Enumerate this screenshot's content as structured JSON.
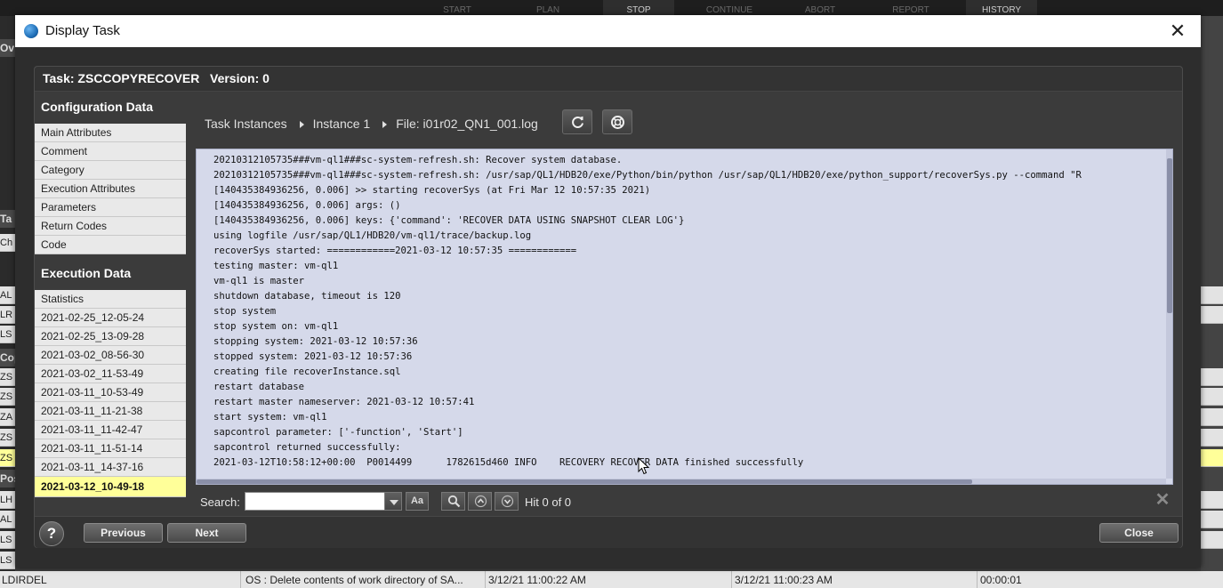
{
  "background": {
    "toolbar_tabs": [
      {
        "label": "START",
        "active": false
      },
      {
        "label": "PLAN",
        "active": false
      },
      {
        "label": "STOP",
        "active": true
      },
      {
        "label": "CONTINUE",
        "active": false
      },
      {
        "label": "ABORT",
        "active": false
      },
      {
        "label": "REPORT",
        "active": false
      },
      {
        "label": "HISTORY",
        "active": true
      }
    ],
    "left_fragments": [
      "Ov",
      "Ta",
      "Ch",
      "AL",
      "LR",
      "LS",
      "Cop",
      "ZS",
      "ZS",
      "ZA",
      "ZS",
      "ZS",
      "Pos",
      "LH",
      "AL",
      "LS",
      "LS"
    ],
    "bottom_row": {
      "name": "LDIRDEL",
      "description": "OS : Delete contents of work directory of SA...",
      "start": "3/12/21 11:00:22 AM",
      "end": "3/12/21 11:00:23 AM",
      "duration": "00:00:01"
    }
  },
  "dialog": {
    "title": "Display Task",
    "task_header": "Task: ZSCCOPYRECOVER   Version: 0",
    "configuration": {
      "heading": "Configuration Data",
      "items": [
        "Main Attributes",
        "Comment",
        "Category",
        "Execution Attributes",
        "Parameters",
        "Return Codes",
        "Code"
      ]
    },
    "execution": {
      "heading": "Execution Data",
      "items": [
        "Statistics",
        "2021-02-25_12-05-24",
        "2021-02-25_13-09-28",
        "2021-03-02_08-56-30",
        "2021-03-02_11-53-49",
        "2021-03-11_10-53-49",
        "2021-03-11_11-21-38",
        "2021-03-11_11-42-47",
        "2021-03-11_11-51-14",
        "2021-03-11_14-37-16",
        "2021-03-12_10-49-18"
      ],
      "selected": "2021-03-12_10-49-18"
    },
    "breadcrumb": {
      "task_instances": "Task Instances",
      "instance": "Instance 1",
      "file": "File: i01r02_QN1_001.log"
    },
    "toolbar_icons": [
      "refresh-icon",
      "lifebuoy-icon"
    ],
    "log_lines": [
      "20210312105735###vm-ql1###sc-system-refresh.sh: Recover system database.",
      "20210312105735###vm-ql1###sc-system-refresh.sh: /usr/sap/QL1/HDB20/exe/Python/bin/python /usr/sap/QL1/HDB20/exe/python_support/recoverSys.py --command \"R",
      "[140435384936256, 0.006] >> starting recoverSys (at Fri Mar 12 10:57:35 2021)",
      "[140435384936256, 0.006] args: ()",
      "[140435384936256, 0.006] keys: {'command': 'RECOVER DATA USING SNAPSHOT CLEAR LOG'}",
      "using logfile /usr/sap/QL1/HDB20/vm-ql1/trace/backup.log",
      "recoverSys started: ============2021-03-12 10:57:35 ============",
      "testing master: vm-ql1",
      "vm-ql1 is master",
      "shutdown database, timeout is 120",
      "stop system",
      "stop system on: vm-ql1",
      "stopping system: 2021-03-12 10:57:36",
      "stopped system: 2021-03-12 10:57:36",
      "creating file recoverInstance.sql",
      "restart database",
      "restart master nameserver: 2021-03-12 10:57:41",
      "start system: vm-ql1",
      "sapcontrol parameter: ['-function', 'Start']",
      "sapcontrol returned successfully:",
      "2021-03-12T10:58:12+00:00  P0014499      1782615d460 INFO    RECOVERY RECOVER DATA finished successfully"
    ],
    "search": {
      "label": "Search:",
      "value": "",
      "case_button": "Aa",
      "hit_text": "Hit 0 of 0"
    },
    "buttons": {
      "help": "?",
      "previous": "Previous",
      "next": "Next",
      "close": "Close"
    },
    "colors": {
      "log_background": "#d5d9ea",
      "selected_item": "#ffff99"
    }
  }
}
